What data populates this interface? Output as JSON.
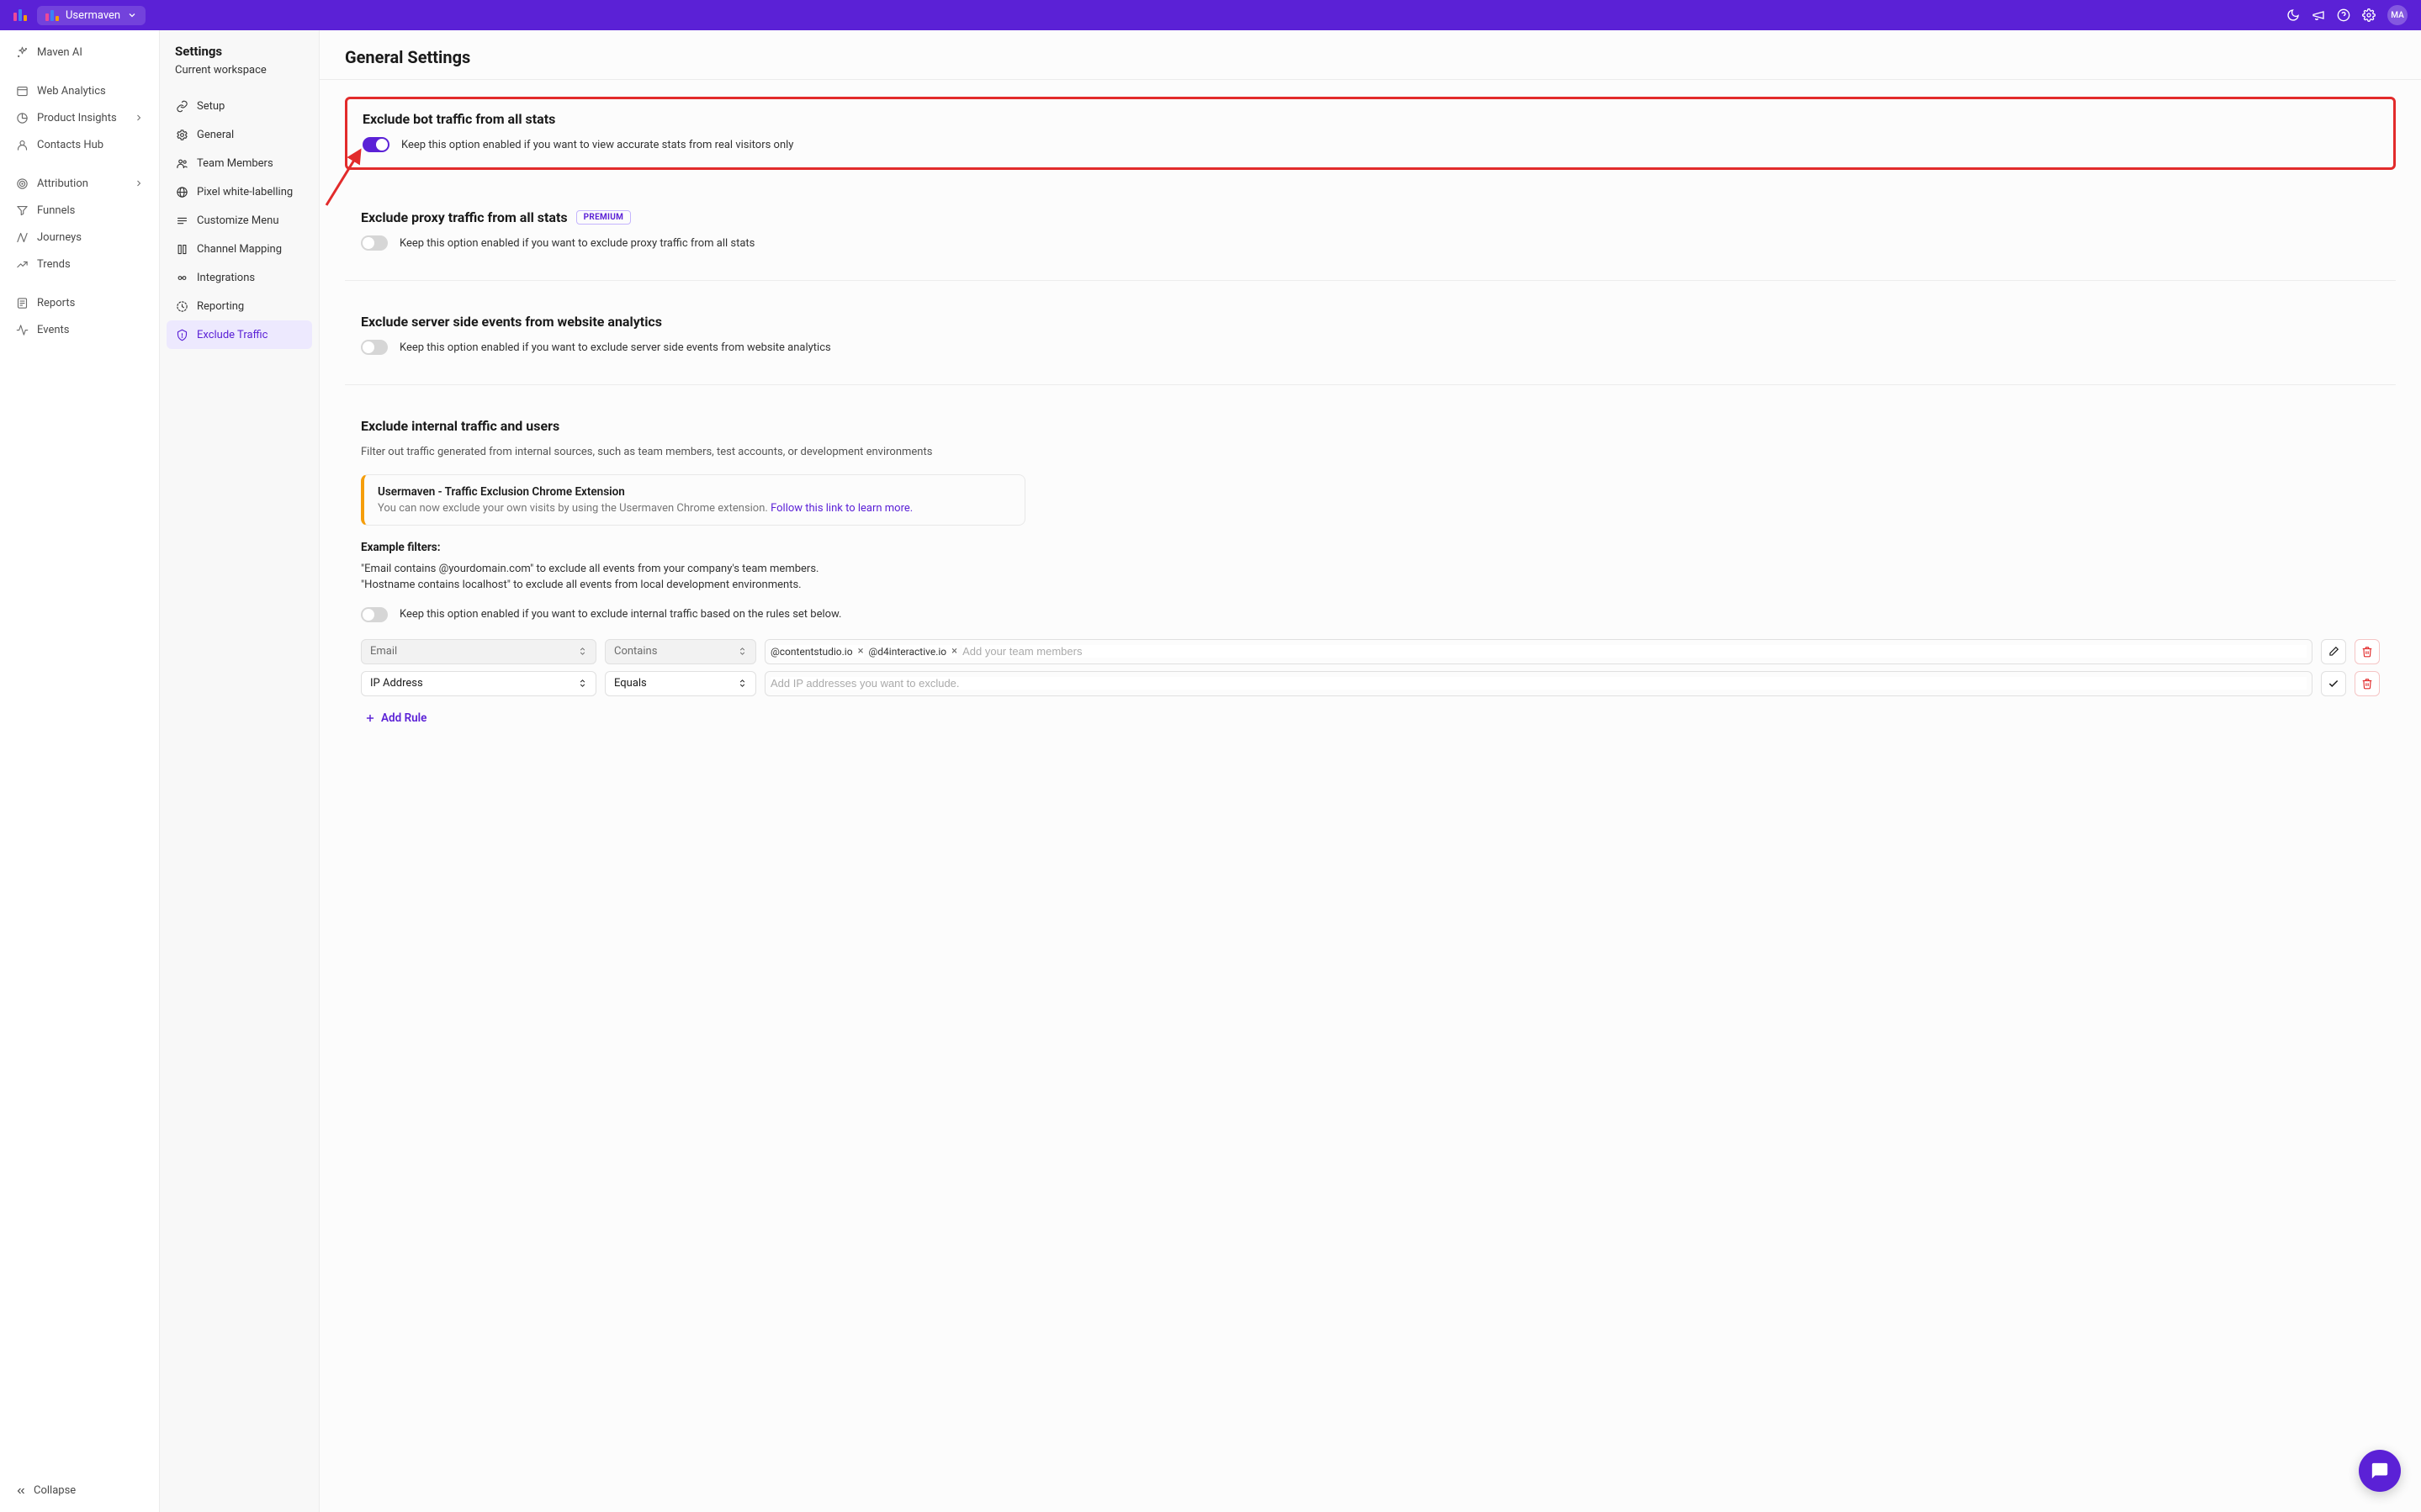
{
  "header": {
    "workspace_name": "Usermaven",
    "avatar_initials": "MA"
  },
  "primary_nav": [
    {
      "label": "Maven AI",
      "icon": "sparkle",
      "gap_after": true
    },
    {
      "label": "Web Analytics",
      "icon": "browser"
    },
    {
      "label": "Product Insights",
      "icon": "pie",
      "chevron": true
    },
    {
      "label": "Contacts Hub",
      "icon": "person",
      "gap_after": true
    },
    {
      "label": "Attribution",
      "icon": "target",
      "chevron": true
    },
    {
      "label": "Funnels",
      "icon": "funnel"
    },
    {
      "label": "Journeys",
      "icon": "journey"
    },
    {
      "label": "Trends",
      "icon": "trend",
      "gap_after": true
    },
    {
      "label": "Reports",
      "icon": "report"
    },
    {
      "label": "Events",
      "icon": "pulse"
    }
  ],
  "collapse_label": "Collapse",
  "subnav": {
    "title": "Settings",
    "subtitle": "Current workspace",
    "items": [
      {
        "label": "Setup",
        "icon": "link"
      },
      {
        "label": "General",
        "icon": "gear"
      },
      {
        "label": "Team Members",
        "icon": "team"
      },
      {
        "label": "Pixel white-labelling",
        "icon": "globe"
      },
      {
        "label": "Customize Menu",
        "icon": "menu"
      },
      {
        "label": "Channel Mapping",
        "icon": "map"
      },
      {
        "label": "Integrations",
        "icon": "integ"
      },
      {
        "label": "Reporting",
        "icon": "report2"
      },
      {
        "label": "Exclude Traffic",
        "icon": "shield",
        "active": true
      }
    ]
  },
  "page_title": "General Settings",
  "sections": {
    "bot": {
      "title": "Exclude bot traffic from all stats",
      "desc": "Keep this option enabled if you want to view accurate stats from real visitors only",
      "enabled": true
    },
    "proxy": {
      "title": "Exclude proxy traffic from all stats",
      "badge": "PREMIUM",
      "desc": "Keep this option enabled if you want to exclude proxy traffic from all stats",
      "enabled": false
    },
    "server": {
      "title": "Exclude server side events from website analytics",
      "desc": "Keep this option enabled if you want to exclude server side events from website analytics",
      "enabled": false
    },
    "internal": {
      "title": "Exclude internal traffic and users",
      "intro": "Filter out traffic generated from internal sources, such as team members, test accounts, or development environments",
      "callout_title": "Usermaven - Traffic Exclusion Chrome Extension",
      "callout_body": "You can now exclude your own visits by using the Usermaven Chrome extension.  ",
      "callout_link": "Follow this link to learn more.",
      "example_header": "Example filters:",
      "example1": "\"Email contains @yourdomain.com\" to exclude all events from your company's team members.",
      "example2": "\"Hostname contains localhost\" to exclude all events from local development environments.",
      "toggle_desc": "Keep this option enabled if you want to exclude internal traffic based on the rules set below.",
      "enabled": false,
      "rules": [
        {
          "field": "Email",
          "operator": "Contains",
          "tags": [
            "@contentstudio.io",
            "@d4interactive.io"
          ],
          "placeholder": "Add your team members",
          "readonly_style": true,
          "action": "edit"
        },
        {
          "field": "IP Address",
          "operator": "Equals",
          "tags": [],
          "placeholder": "Add IP addresses you want to exclude.",
          "readonly_style": false,
          "action": "check"
        }
      ],
      "add_rule_label": "Add Rule"
    }
  }
}
